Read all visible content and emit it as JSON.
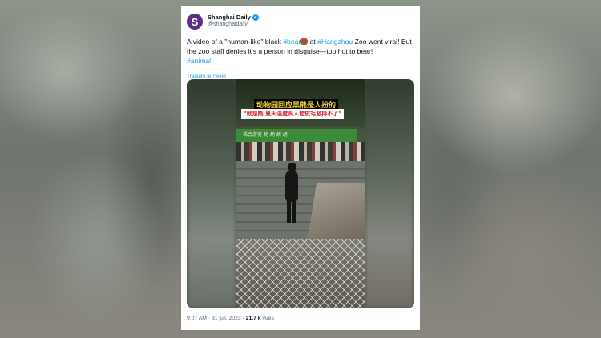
{
  "tweet": {
    "author_name": "Shanghai Daily",
    "avatar_letter": "S",
    "handle": "@shanghaidaily",
    "more": "···",
    "text": {
      "part1": "A video of a \"human-like\" black ",
      "tag_bear": "#bear",
      "part2": " at ",
      "tag_hangzhou": "#Hangzhou",
      "part3": " Zoo went viral! But the zoo staff denies it's a person in disguise—too hot to bear!",
      "tag_animal": "#animal"
    },
    "translate_label": "Traduire le Tweet",
    "video": {
      "caption_line1": "动物园回应黑熊是人扮的",
      "caption_line2": "\"就是熊 夏天温度高人套皮毛坚持不了\"",
      "sign_text": "株会游览 胡 胡 胡 胡"
    },
    "footer": {
      "time": "9:07 AM",
      "sep1": " · ",
      "date": "31 juil. 2023",
      "sep2": " · ",
      "views_count": "21,7 k",
      "views_label": " vues"
    }
  },
  "colors": {
    "link": "#1d9bf0",
    "avatar": "#5a2f8c"
  },
  "icons": [
    "verified-badge-icon",
    "bear-emoji-icon",
    "more-options-icon"
  ]
}
